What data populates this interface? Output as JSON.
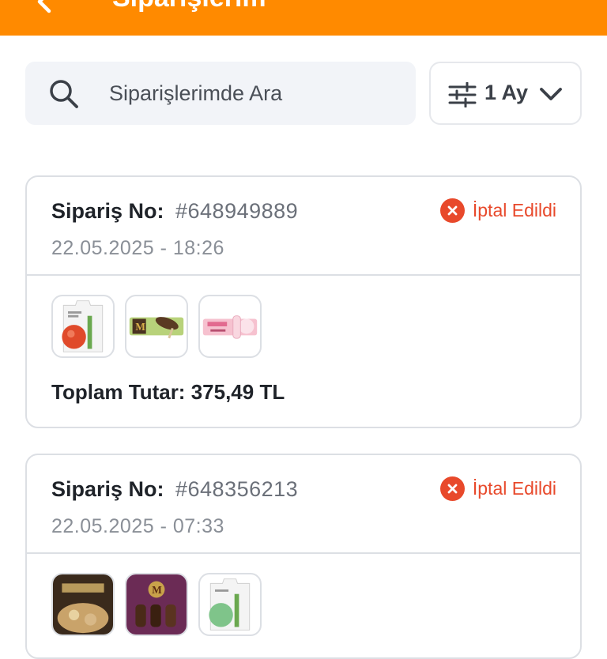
{
  "header": {
    "title": "Siparişlerim",
    "back_icon": "chevron-left-icon",
    "background_color": "#ff8a00"
  },
  "search": {
    "placeholder": "Siparişlerimde Ara",
    "value": "",
    "icon": "search-icon"
  },
  "filter": {
    "label": "1 Ay",
    "icon": "sliders-icon",
    "dropdown_icon": "chevron-down-icon"
  },
  "orders": [
    {
      "order_no_label": "Sipariş No:",
      "order_no": "#648949889",
      "date": "22.05.2025 - 18:26",
      "status": "İptal Edildi",
      "status_color": "#e8492b",
      "status_icon": "cancel-icon",
      "products": [
        "bag-product",
        "magnum-ice-cream",
        "pink-ice-cream"
      ],
      "total": "Toplam Tutar: 375,49 TL"
    },
    {
      "order_no_label": "Sipariş No:",
      "order_no": "#648356213",
      "date": "22.05.2025 - 07:33",
      "status": "İptal Edildi",
      "status_color": "#e8492b",
      "status_icon": "cancel-icon",
      "products": [
        "carte-dor-ice-cream",
        "magnum-multipack",
        "bag-product"
      ]
    }
  ]
}
